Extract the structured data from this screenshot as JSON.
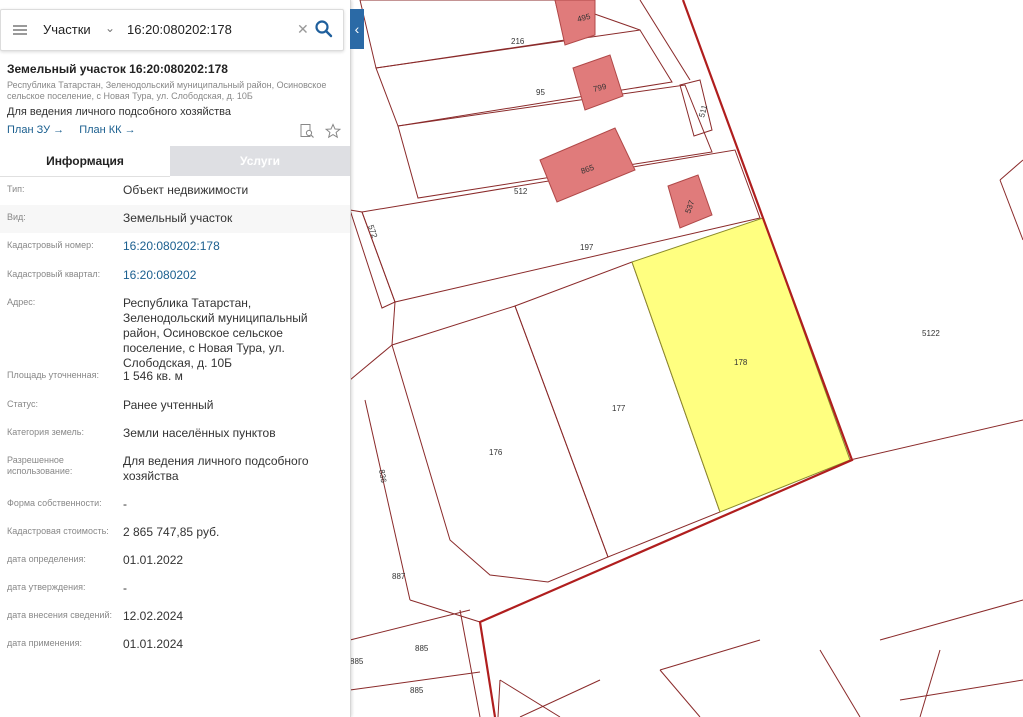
{
  "search": {
    "layer": "Участки",
    "value": "16:20:080202:178"
  },
  "card": {
    "title": "Земельный участок 16:20:080202:178",
    "address_short": "Республика Татарстан, Зеленодольский муниципальный район, Осиновское сельское поселение, с Новая Тура, ул. Слободская, д. 10Б",
    "purpose": "Для ведения личного подсобного хозяйства",
    "link_plan_zu": "План ЗУ →",
    "link_plan_kk": "План КК →"
  },
  "tabs": {
    "info": "Информация",
    "services": "Услуги"
  },
  "rows": [
    {
      "label": "Тип:",
      "value": "Объект недвижимости"
    },
    {
      "label": "Вид:",
      "value": "Земельный участок"
    },
    {
      "label": "Кадастровый номер:",
      "value": "16:20:080202:178"
    },
    {
      "label": "Кадастровый квартал:",
      "value": "16:20:080202"
    },
    {
      "label": "Адрес:",
      "value": "Республика Татарстан, Зеленодольский муниципальный район, Осиновское сельское поселение, с Новая Тура, ул. Слободская, д. 10Б"
    },
    {
      "label": "Площадь уточненная:",
      "value": "1 546 кв. м"
    },
    {
      "label": "Статус:",
      "value": "Ранее учтенный"
    },
    {
      "label": "Категория земель:",
      "value": "Земли населённых пунктов"
    },
    {
      "label": "Разрешенное использование:",
      "value": "Для ведения личного подсобного хозяйства"
    },
    {
      "label": "Форма собственности:",
      "value": "-"
    },
    {
      "label": "Кадастровая стоимость:",
      "value": "2 865 747,85 руб."
    },
    {
      "label": "дата определения:",
      "value": "01.01.2022"
    },
    {
      "label": "дата утверждения:",
      "value": "-"
    },
    {
      "label": "дата внесения сведений:",
      "value": "12.02.2024"
    },
    {
      "label": "дата применения:",
      "value": "01.01.2024"
    }
  ],
  "map_labels": {
    "p495": "495",
    "p216": "216",
    "p95": "95",
    "p799": "799",
    "p511": "511",
    "p865": "865",
    "p512": "512",
    "p537": "537",
    "p572": "572",
    "p197": "197",
    "p178": "178",
    "p5122": "5122",
    "p177": "177",
    "p176": "176",
    "p836": "836",
    "p887": "887",
    "p885a": "885",
    "p885b": "885",
    "p885c": "885"
  },
  "colors": {
    "accent": "#2b6aa6",
    "link": "#1b5f8f",
    "parcel_line": "#8a2a2a",
    "quarter_line": "#b01e1e",
    "selected_fill": "#ffff80",
    "building_fill": "#e07b7b"
  }
}
